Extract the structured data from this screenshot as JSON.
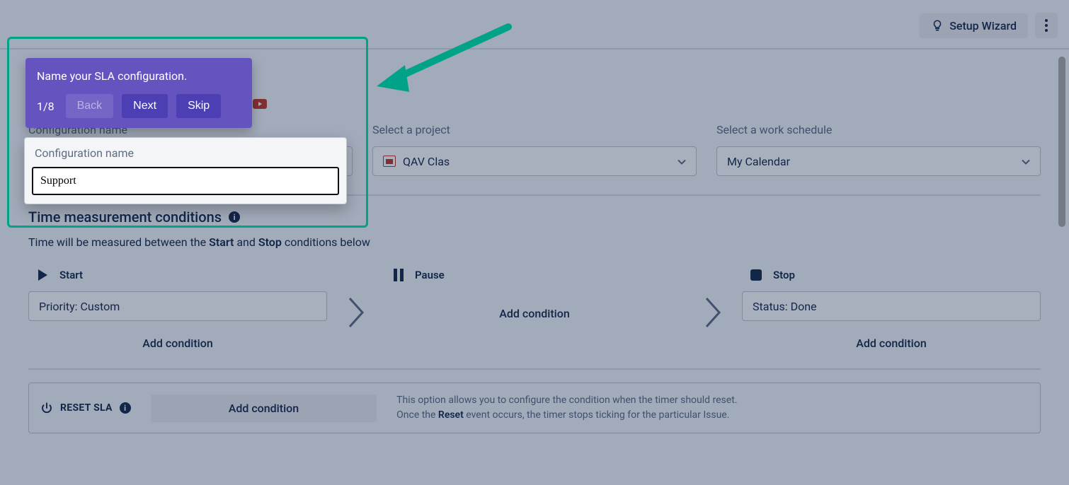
{
  "topbar": {
    "setup_wizard_label": "Setup Wizard"
  },
  "form": {
    "config_name_label": "Configuration name",
    "config_name_value": "Support",
    "project_label": "Select a project",
    "project_value": "QAV Clas",
    "schedule_label": "Select a work schedule",
    "schedule_value": "My Calendar"
  },
  "sections": {
    "time_title": "Time measurement conditions",
    "time_desc_pre": "Time will be measured between the ",
    "time_desc_start": "Start",
    "time_desc_mid": " and ",
    "time_desc_stop": "Stop",
    "time_desc_post": " conditions below"
  },
  "conditions": {
    "start_label": "Start",
    "start_value": "Priority: Custom",
    "pause_label": "Pause",
    "pause_add": "Add condition",
    "stop_label": "Stop",
    "stop_value": "Status: Done",
    "add_condition": "Add condition"
  },
  "reset": {
    "label": "RESET SLA",
    "add_label": "Add condition",
    "desc_line1": "This option allows you to configure the condition when the timer should reset.",
    "desc_line2_pre": "Once the ",
    "desc_line2_bold": "Reset",
    "desc_line2_post": " event occurs, the timer stops ticking for the particular Issue."
  },
  "tour": {
    "message": "Name your SLA configuration.",
    "step": "1/8",
    "back": "Back",
    "next": "Next",
    "skip": "Skip"
  }
}
